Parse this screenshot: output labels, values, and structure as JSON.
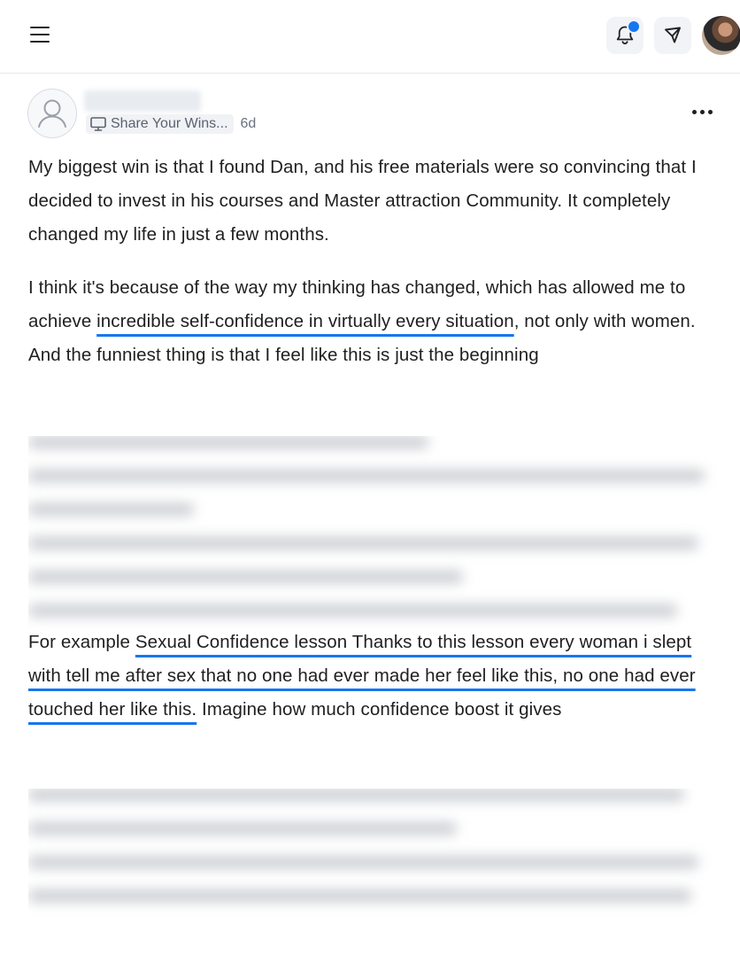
{
  "header": {
    "menu_icon": "hamburger-menu-icon",
    "bell_icon": "bell-icon",
    "send_icon": "paper-plane-icon",
    "notification_dot_color": "#1677f0"
  },
  "post": {
    "category": "Share Your Wins...",
    "category_icon": "monitor-icon",
    "age": "6d",
    "more_icon": "more-dots-icon",
    "para1": "My biggest win is that I found Dan, and his free materials were so convincing that I decided to invest in his courses and Master attraction Community. It completely changed my life in just a few months.",
    "para2_a": "I think it's because of the way my thinking has changed, which has allowed me to achieve ",
    "para2_highlight": "incredible self-confidence in virtually every situation",
    "para2_b": ", not only with women. And the funniest thing is that I feel like this is just the beginning",
    "para3_a": "For example ",
    "para3_highlight": "Sexual Confidence lesson Thanks to this lesson every woman i slept with tell me after sex that no one had ever made her feel like this, no one had ever touched her like this.",
    "para3_b": " Imagine how much confidence boost it gives"
  },
  "colors": {
    "accent": "#1677f0",
    "text": "#1f1f1f"
  }
}
